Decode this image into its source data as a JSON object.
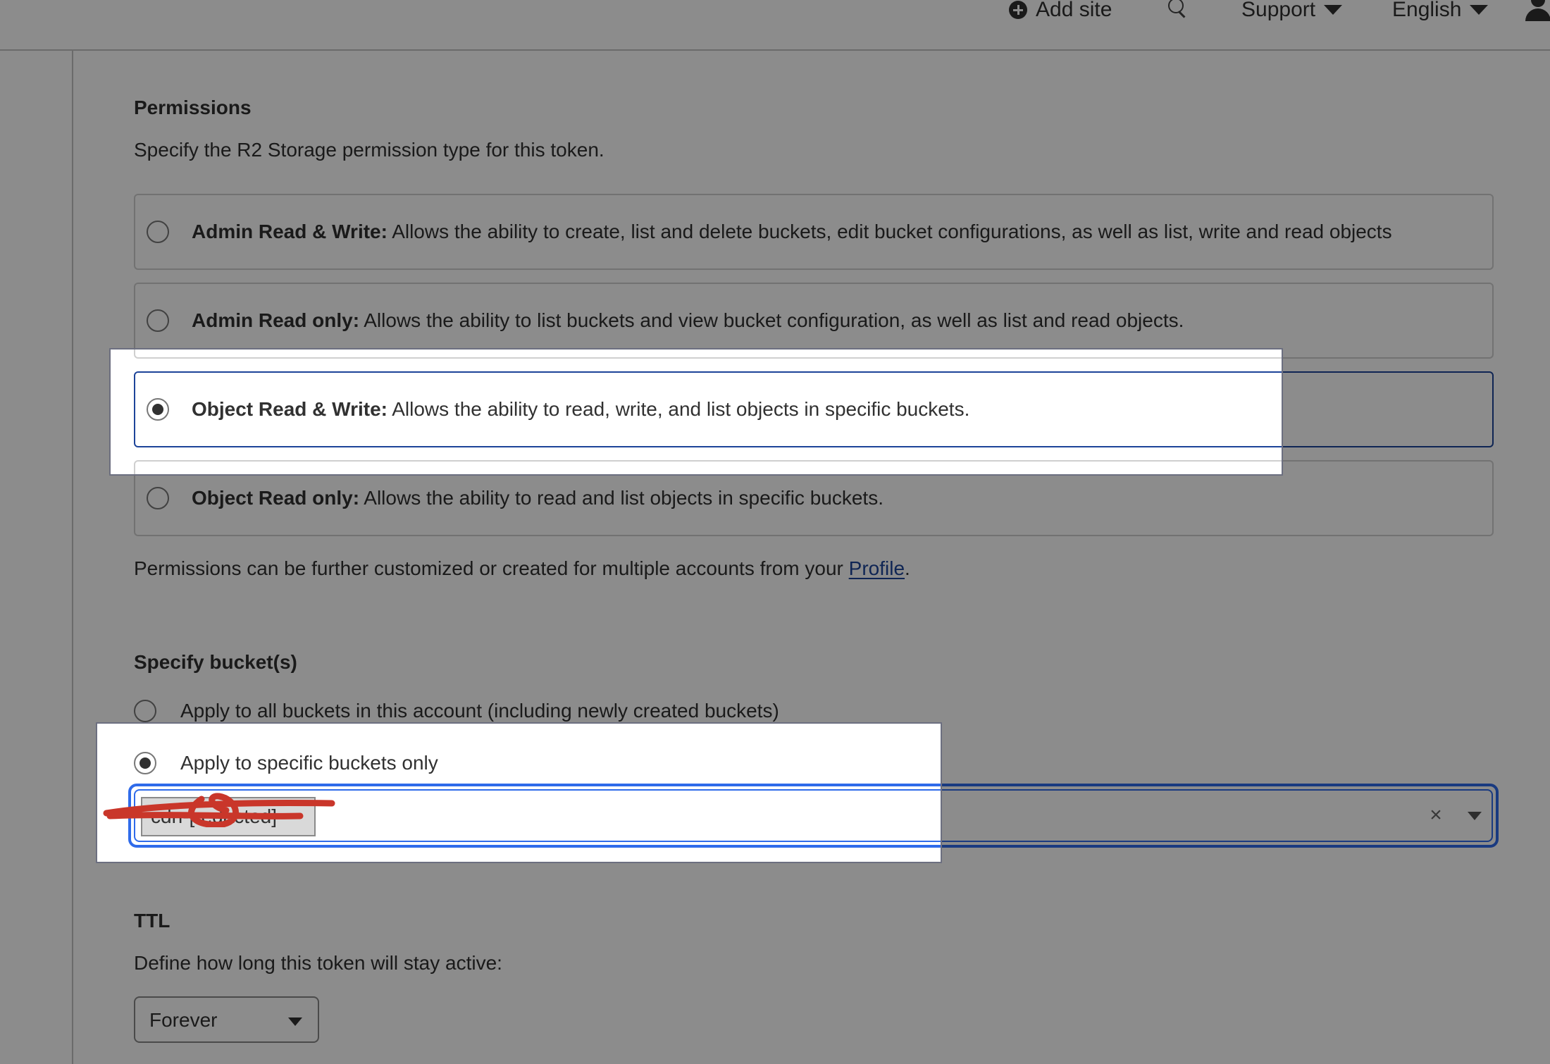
{
  "header": {
    "add_site_label": "Add site",
    "search_icon": "search-icon",
    "support_label": "Support",
    "language_label": "English",
    "user_icon": "user-icon"
  },
  "permissions": {
    "title": "Permissions",
    "description": "Specify the R2 Storage permission type for this token.",
    "options": [
      {
        "title": "Admin Read & Write:",
        "text": " Allows the ability to create, list and delete buckets, edit bucket configurations, as well as list, write and read objects",
        "selected": false
      },
      {
        "title": "Admin Read only:",
        "text": " Allows the ability to list buckets and view bucket configuration, as well as list and read objects.",
        "selected": false
      },
      {
        "title": "Object Read & Write:",
        "text": " Allows the ability to read, write, and list objects in specific buckets.",
        "selected": true
      },
      {
        "title": "Object Read only:",
        "text": " Allows the ability to read and list objects in specific buckets.",
        "selected": false
      }
    ],
    "note_prefix": "Permissions can be further customized or created for multiple accounts from your ",
    "note_link": "Profile",
    "note_suffix": "."
  },
  "buckets": {
    "title": "Specify bucket(s)",
    "option_all": "Apply to all buckets in this account (including newly created buckets)",
    "option_specific": "Apply to specific buckets only",
    "selected_option": "specific",
    "selected_bucket": "cdn-[redacted]",
    "clear_icon": "×"
  },
  "ttl": {
    "title": "TTL",
    "description": "Define how long this token will stay active:",
    "value": "Forever"
  },
  "colors": {
    "accent": "#1d4499",
    "focus": "#2f6bea",
    "redaction": "#c9362a"
  }
}
